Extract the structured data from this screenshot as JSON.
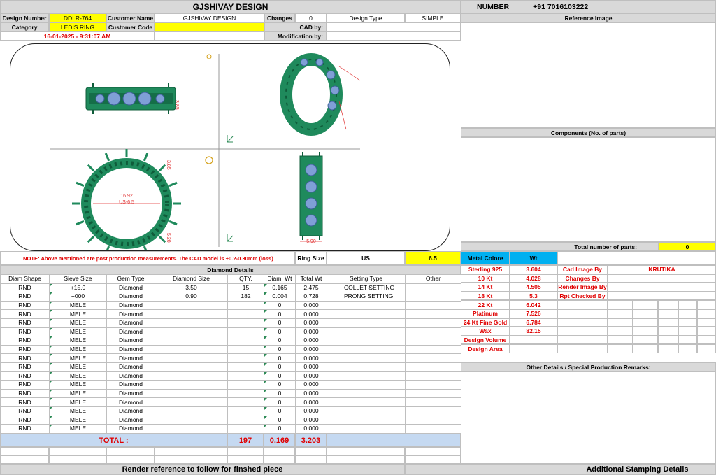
{
  "header": {
    "company": "GJSHIVAY DESIGN",
    "number_label": "NUMBER",
    "number_value": "+91 7016103222"
  },
  "info": {
    "design_number_label": "Design Number",
    "design_number": "DDLR-764",
    "customer_name_label": "Customer Name",
    "customer_name": "GJSHIVAY DESIGN",
    "changes_label": "Changes",
    "changes": "0",
    "design_type_label": "Design Type",
    "design_type": "SIMPLE",
    "category_label": "Category",
    "category": "LEDIS RING",
    "customer_code_label": "Customer Code",
    "customer_code": "",
    "cad_by_label": "CAD by:",
    "cad_by": "",
    "datetime": "16-01-2025 - 9:31:07 AM",
    "modification_label": "Modification by:",
    "modification_by": ""
  },
  "right_panel": {
    "reference_image": "Reference Image",
    "components": "Components (No. of parts)",
    "total_parts_label": "Total number of parts:",
    "total_parts": "0"
  },
  "cad_labels": {
    "inner_diameter": "16.92",
    "us_size": "US-6.5",
    "dim_height": "3.85",
    "dim_side": "5.20",
    "dim_width": "5.90",
    "dim_top": "5.90"
  },
  "note": {
    "text": "NOTE: Above mentioned are post production measurements. The CAD model is +0.2-0.30mm (loss)",
    "ring_size_label": "Ring Size",
    "ring_standard": "US",
    "ring_size": "6.5"
  },
  "diamond": {
    "title": "Diamond Details",
    "headers": [
      "Diam Shape",
      "Sieve Size",
      "Gem Type",
      "Diamond Size",
      "QTY.",
      "Diam. Wt",
      "Total Wt",
      "Setting Type",
      "Other"
    ],
    "rows": [
      [
        "RND",
        "+15.0",
        "Diamond",
        "3.50",
        "15",
        "0.165",
        "2.475",
        "COLLET SETTING",
        ""
      ],
      [
        "RND",
        "+000",
        "Diamond",
        "0.90",
        "182",
        "0.004",
        "0.728",
        "PRONG SETTING",
        ""
      ],
      [
        "RND",
        "MELE",
        "Diamond",
        "",
        "",
        "0",
        "0.000",
        "",
        ""
      ],
      [
        "RND",
        "MELE",
        "Diamond",
        "",
        "",
        "0",
        "0.000",
        "",
        ""
      ],
      [
        "RND",
        "MELE",
        "Diamond",
        "",
        "",
        "0",
        "0.000",
        "",
        ""
      ],
      [
        "RND",
        "MELE",
        "Diamond",
        "",
        "",
        "0",
        "0.000",
        "",
        ""
      ],
      [
        "RND",
        "MELE",
        "Diamond",
        "",
        "",
        "0",
        "0.000",
        "",
        ""
      ],
      [
        "RND",
        "MELE",
        "Diamond",
        "",
        "",
        "0",
        "0.000",
        "",
        ""
      ],
      [
        "RND",
        "MELE",
        "Diamond",
        "",
        "",
        "0",
        "0.000",
        "",
        ""
      ],
      [
        "RND",
        "MELE",
        "Diamond",
        "",
        "",
        "0",
        "0.000",
        "",
        ""
      ],
      [
        "RND",
        "MELE",
        "Diamond",
        "",
        "",
        "0",
        "0.000",
        "",
        ""
      ],
      [
        "RND",
        "MELE",
        "Diamond",
        "",
        "",
        "0",
        "0.000",
        "",
        ""
      ],
      [
        "RND",
        "MELE",
        "Diamond",
        "",
        "",
        "0",
        "0.000",
        "",
        ""
      ],
      [
        "RND",
        "MELE",
        "Diamond",
        "",
        "",
        "0",
        "0.000",
        "",
        ""
      ],
      [
        "RND",
        "MELE",
        "Diamond",
        "",
        "",
        "0",
        "0.000",
        "",
        ""
      ],
      [
        "RND",
        "MELE",
        "Diamond",
        "",
        "",
        "0",
        "0.000",
        "",
        ""
      ],
      [
        "RND",
        "MELE",
        "Diamond",
        "",
        "",
        "0",
        "0.000",
        "",
        ""
      ],
      [
        "RND",
        "MELE",
        "Diamond",
        "",
        "",
        "0",
        "0.000",
        "",
        ""
      ]
    ],
    "total_label": "TOTAL :",
    "total_qty": "197",
    "total_diam_wt": "0.169",
    "total_wt": "3.203"
  },
  "metal": {
    "header_color": "Metal Colore",
    "header_wt": "Wt",
    "rows": [
      {
        "name": "Sterling 925",
        "wt": "3.604",
        "label": "Cad Image By",
        "value": "KRUTIKA"
      },
      {
        "name": "10 Kt",
        "wt": "4.028",
        "label": "Changes By",
        "value": ""
      },
      {
        "name": "14 Kt",
        "wt": "4.505",
        "label": "Render Image By",
        "value": ""
      },
      {
        "name": "18 Kt",
        "wt": "5.3",
        "label": "Rpt Checked By",
        "value": ""
      },
      {
        "name": "22 Kt",
        "wt": "6.042",
        "label": "",
        "value": ""
      },
      {
        "name": "Platinum",
        "wt": "7.526",
        "label": "",
        "value": ""
      },
      {
        "name": "24 Kt Fine Gold",
        "wt": "6.784",
        "label": "",
        "value": ""
      },
      {
        "name": "Wax",
        "wt": "82.15",
        "label": "",
        "value": ""
      },
      {
        "name": "Design Volume",
        "wt": "",
        "label": "",
        "value": ""
      },
      {
        "name": "Design Area",
        "wt": "",
        "label": "",
        "value": ""
      }
    ],
    "other_details": "Other Details / Special Production Remarks:"
  },
  "footer": {
    "render_reference": "Render reference to follow for finshed piece",
    "stamping": "Additional Stamping Details"
  },
  "colors": {
    "ring_green": "#1f8a5c",
    "ring_dark": "#0f5c3a",
    "stone_blue": "#7f9fd6",
    "dim_red": "#e03030"
  }
}
